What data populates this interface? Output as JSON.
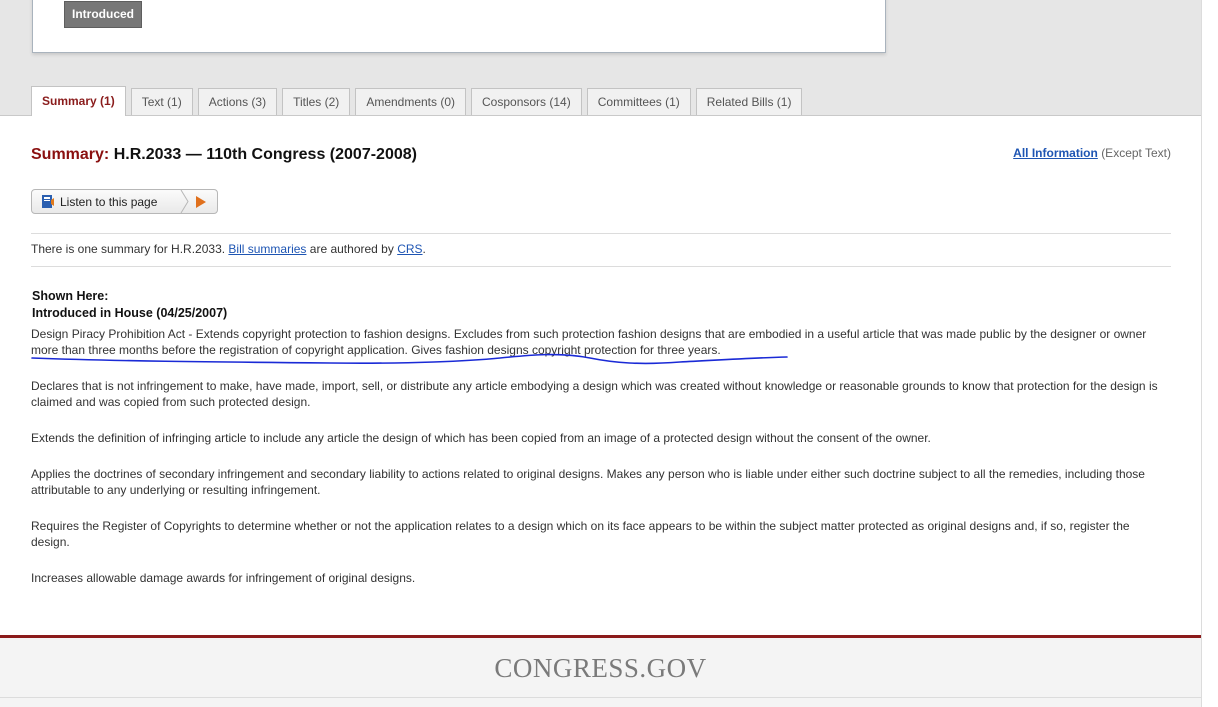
{
  "status": {
    "label": "Introduced"
  },
  "tabs": [
    {
      "label": "Summary (1)",
      "active": true
    },
    {
      "label": "Text (1)"
    },
    {
      "label": "Actions (3)"
    },
    {
      "label": "Titles (2)"
    },
    {
      "label": "Amendments (0)"
    },
    {
      "label": "Cosponsors (14)"
    },
    {
      "label": "Committees (1)"
    },
    {
      "label": "Related Bills (1)"
    }
  ],
  "heading": {
    "label": "Summary:",
    "title": "H.R.2033 — 110th Congress (2007-2008)"
  },
  "all_info": {
    "link": "All Information",
    "suffix": "(Except Text)"
  },
  "listen": {
    "label": "Listen to this page",
    "icon": "speaker-icon",
    "play_icon": "play-icon"
  },
  "intro": {
    "prefix": "There is one summary for H.R.2033.",
    "link1": "Bill summaries",
    "middle": "are authored by",
    "link2": "CRS",
    "suffix": "."
  },
  "shown": {
    "line1": "Shown Here:",
    "line2": "Introduced in House (04/25/2007)"
  },
  "paragraphs": [
    "Design Piracy Prohibition Act - Extends copyright protection to fashion designs. Excludes from such protection fashion designs that are embodied in a useful article that was made public by the designer or owner more than three months before the registration of copyright application. Gives fashion designs copyright protection for three years.",
    "Declares that is not infringement to make, have made, import, sell, or distribute any article embodying a design which was created without knowledge or reasonable grounds to know that protection for the design is claimed and was copied from such protected design.",
    "Extends the definition of infringing article to include any article the design of which has been copied from an image of a protected design without the consent of the owner.",
    "Applies the doctrines of secondary infringement and secondary liability to actions related to original designs. Makes any person who is liable under either such doctrine subject to all the remedies, including those attributable to any underlying or resulting infringement.",
    "Requires the Register of Copyrights to determine whether or not the application relates to a design which on its face appears to be within the subject matter protected as original designs and, if so, register the design.",
    "Increases allowable damage awards for infringement of original designs."
  ],
  "footer": {
    "logo": "CONGRESS.GOV"
  },
  "colors": {
    "accent": "#8a1c1c",
    "link": "#1e55b3",
    "annotation": "#1a2ad6"
  }
}
